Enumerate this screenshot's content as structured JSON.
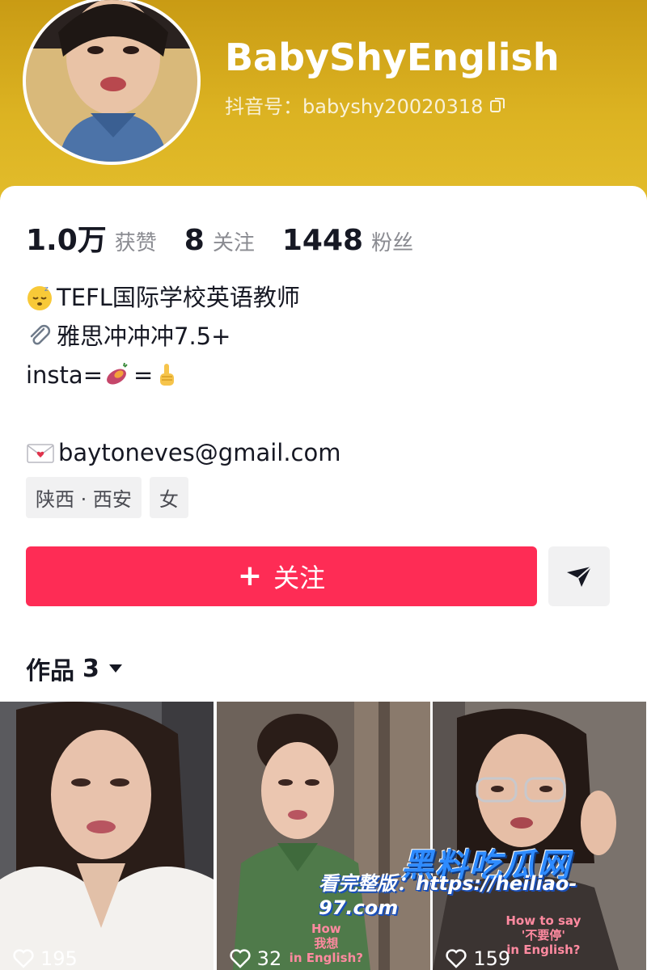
{
  "profile": {
    "username": "BabyShyEnglish",
    "douyin_id": "抖音号：babyshy20020318"
  },
  "stats": [
    {
      "value": "1.0万",
      "label": "获赞"
    },
    {
      "value": "8",
      "label": "关注"
    },
    {
      "value": "1448",
      "label": "粉丝"
    }
  ],
  "bio": {
    "line1": "TEFL国际学校英语教师",
    "line2": "雅思冲冲冲7.5+",
    "line3_prefix": "insta=",
    "line3_mid": "=",
    "email": "baytoneves@gmail.com"
  },
  "tags": [
    "陕西 · 西安",
    "女"
  ],
  "actions": {
    "follow_label": "关注",
    "follow_icon": "+"
  },
  "works": {
    "label": "作品",
    "count": "3"
  },
  "videos": [
    {
      "likes": "195",
      "overlay": ""
    },
    {
      "likes": "32",
      "overlay_lines": [
        "How",
        "我想",
        "in English?"
      ]
    },
    {
      "likes": "159",
      "overlay_lines": [
        "How to say",
        "'不要停'",
        "in English?"
      ]
    }
  ],
  "watermark": {
    "title": "黑料吃瓜网",
    "url": "看完整版：https://heiliao-97.com"
  },
  "colors": {
    "accent": "#fe2c55",
    "header": "#dcb322"
  }
}
